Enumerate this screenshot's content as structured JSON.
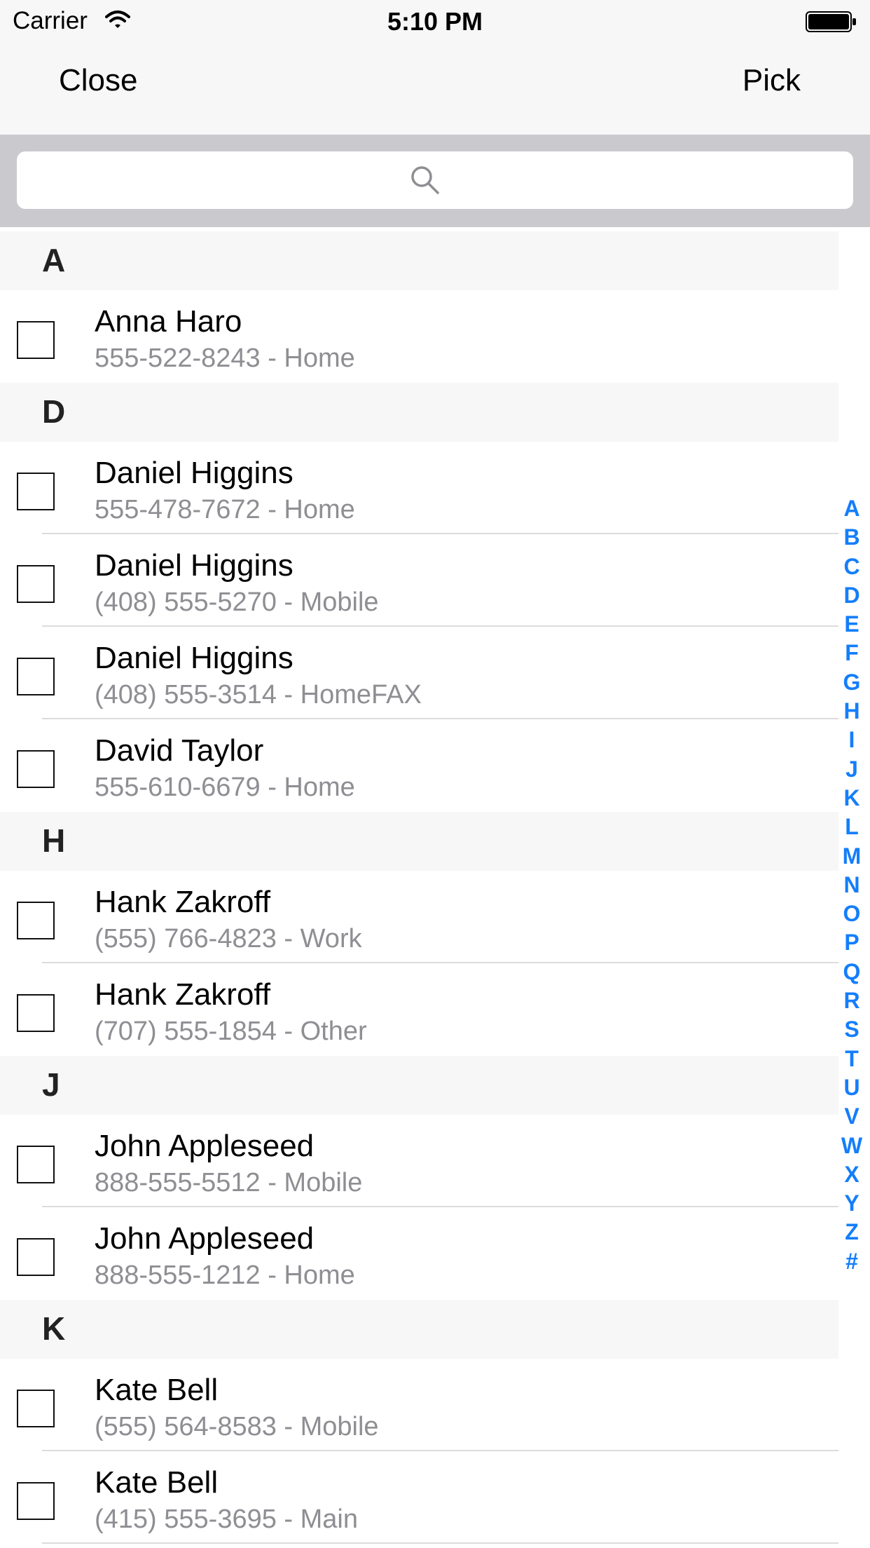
{
  "status_bar": {
    "carrier": "Carrier",
    "time": "5:10 PM"
  },
  "nav": {
    "left": "Close",
    "right": "Pick"
  },
  "search": {
    "placeholder": ""
  },
  "colors": {
    "accent": "#147efb",
    "section_bg": "#f7f7f7",
    "secondary_text": "#8e8e93",
    "search_bg": "#c9c9ce"
  },
  "sections": [
    {
      "letter": "A",
      "rows": [
        {
          "name": "Anna Haro",
          "detail": "555-522-8243 - Home"
        }
      ]
    },
    {
      "letter": "D",
      "rows": [
        {
          "name": "Daniel Higgins",
          "detail": "555-478-7672 - Home"
        },
        {
          "name": "Daniel Higgins",
          "detail": "(408) 555-5270 - Mobile"
        },
        {
          "name": "Daniel Higgins",
          "detail": "(408) 555-3514 - HomeFAX"
        },
        {
          "name": "David Taylor",
          "detail": "555-610-6679 - Home"
        }
      ]
    },
    {
      "letter": "H",
      "rows": [
        {
          "name": "Hank Zakroff",
          "detail": "(555) 766-4823 - Work"
        },
        {
          "name": "Hank Zakroff",
          "detail": "(707) 555-1854 - Other"
        }
      ]
    },
    {
      "letter": "J",
      "rows": [
        {
          "name": "John Appleseed",
          "detail": "888-555-5512 - Mobile"
        },
        {
          "name": "John Appleseed",
          "detail": "888-555-1212 - Home"
        }
      ]
    },
    {
      "letter": "K",
      "rows": [
        {
          "name": "Kate Bell",
          "detail": "(555) 564-8583 - Mobile"
        },
        {
          "name": "Kate Bell",
          "detail": "(415) 555-3695 - Main"
        }
      ]
    }
  ],
  "index_letters": [
    "A",
    "B",
    "C",
    "D",
    "E",
    "F",
    "G",
    "H",
    "I",
    "J",
    "K",
    "L",
    "M",
    "N",
    "O",
    "P",
    "Q",
    "R",
    "S",
    "T",
    "U",
    "V",
    "W",
    "X",
    "Y",
    "Z",
    "#"
  ]
}
